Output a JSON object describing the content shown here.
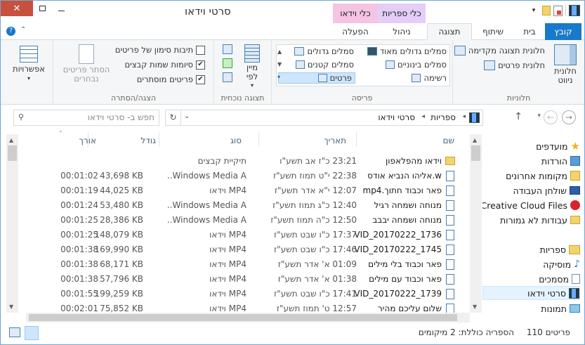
{
  "window": {
    "title": "סרטי וידאו"
  },
  "context_tabs": {
    "video_tools": "כלי וידאו",
    "library_tools": "כלי ספריות"
  },
  "tabs": [
    {
      "label": "קובץ"
    },
    {
      "label": "בית"
    },
    {
      "label": "שיתוף"
    },
    {
      "label": "תצוגה"
    },
    {
      "label": "ניהול"
    },
    {
      "label": "הפעלה"
    }
  ],
  "ribbon": {
    "panes": {
      "nav_pane": "חלונית ניווט",
      "preview_pane": "חלונית תצוגה מקדימה",
      "details_pane": "חלונית פרטים",
      "label": "חלוניות"
    },
    "layout": {
      "extra_large_icons": "סמלים גדולים מאוד",
      "large_icons": "סמלים גדולים",
      "medium_icons": "סמלים בינוניים",
      "small_icons": "סמלים קטנים",
      "list": "רשימה",
      "details": "פרטים",
      "label": "פריסה"
    },
    "current_view": {
      "sort_by": "מיין לפי",
      "label": "תצוגה נוכחית"
    },
    "show_hide": {
      "item_checkboxes": "תיבות סימון של פריטים",
      "file_extensions": "סיומות שמות קבצים",
      "hidden_items": "פריטים מוסתרים",
      "hide_selected": "הסתר פריטים נבחרים",
      "label": "הצגה/הסתרה"
    },
    "options": "אפשרויות"
  },
  "address": {
    "path_root": "ספריות",
    "path_leaf": "סרטי וידאו"
  },
  "search": {
    "placeholder": "חפש ב- סרטי וידאו"
  },
  "columns": {
    "name": "שם",
    "date": "תאריך",
    "type": "סוג",
    "size": "גודל",
    "length": "אורך"
  },
  "files": [
    {
      "name": "וידאו מהפלאפון",
      "date": "23:21 כ\"ז אב תשע\"ו",
      "type": "תיקיית קבצים",
      "size": "",
      "length": "",
      "icon": "folder"
    },
    {
      "name": "w.אליהו הנביא אודס",
      "date": "22:38 י\"ט תמוז תשע\"ז",
      "type": "Windows Media A...",
      "size": "43,698 KB",
      "length": "00:01:02",
      "icon": "video"
    },
    {
      "name": "פאר וכבוד חתוך.mp4",
      "date": "12:07 י\"א אדר תשע\"ז",
      "type": "MP4 וידאו",
      "size": "44,025 KB",
      "length": "00:01:19",
      "icon": "video"
    },
    {
      "name": "מנוחה ושמחה רגיל",
      "date": "12:40 כ\"ג תמוז תשע\"ז",
      "type": "Windows Media A...",
      "size": "53,480 KB",
      "length": "00:01:24",
      "icon": "video"
    },
    {
      "name": "מנוחה ושמחה יבבב",
      "date": "12:50 כ\"ה תמוז תשע\"ז",
      "type": "Windows Media A...",
      "size": "28,386 KB",
      "length": "00:01:25",
      "icon": "video"
    },
    {
      "name": "VID_20170222_1736...",
      "date": "17:37 כ\"ו שבט תשע\"ז",
      "type": "MP4 וידאו",
      "size": "148,079 KB",
      "length": "00:01:25",
      "icon": "video"
    },
    {
      "name": "VID_20170222_1745...",
      "date": "17:46 כ\"ו שבט תשע\"ז",
      "type": "MP4 וידאו",
      "size": "169,990 KB",
      "length": "00:01:38",
      "icon": "video"
    },
    {
      "name": "פאר וכבוד בלי מילים",
      "date": "01:09 א' אדר תשע\"ז",
      "type": "MP4 וידאו",
      "size": "68,171 KB",
      "length": "00:01:38",
      "icon": "video"
    },
    {
      "name": "פאר וכבוד עם מילים",
      "date": "01:38 א' אדר תשע\"ז",
      "type": "MP4 וידאו",
      "size": "57,796 KB",
      "length": "00:01:38",
      "icon": "video"
    },
    {
      "name": "VID_20170222_1739...",
      "date": "17:41 כ\"ו שבט תשע\"ז",
      "type": "MP4 וידאו",
      "size": "199,259 KB",
      "length": "00:01:55",
      "icon": "video"
    },
    {
      "name": "שלום עליכם מהיר",
      "date": "12:57 ט' תמוז תשע\"ז",
      "type": "MP4 וידאו",
      "size": "75,852 KB",
      "length": "00:02:01",
      "icon": "video"
    }
  ],
  "nav": {
    "favorites": "מועדפים",
    "downloads": "הורדות",
    "recent": "מקומות אחרונים",
    "desktop": "שולחן העבודה",
    "cc_files": "Creative Cloud Files",
    "unfinished": "עבודות לא גמורות",
    "libraries": "ספריות",
    "music": "מוסיקה",
    "documents": "מסמכים",
    "videos": "סרטי וידאו",
    "pictures": "תמונות"
  },
  "status": {
    "items": "110 פריטים",
    "library_includes": "הספריה כוללת: 2 מיקומים"
  },
  "colors": {
    "accent": "#1979ca",
    "close": "#c7503f",
    "video_ctx": "#f5c4e3",
    "lib_ctx": "#e4cdf6"
  }
}
